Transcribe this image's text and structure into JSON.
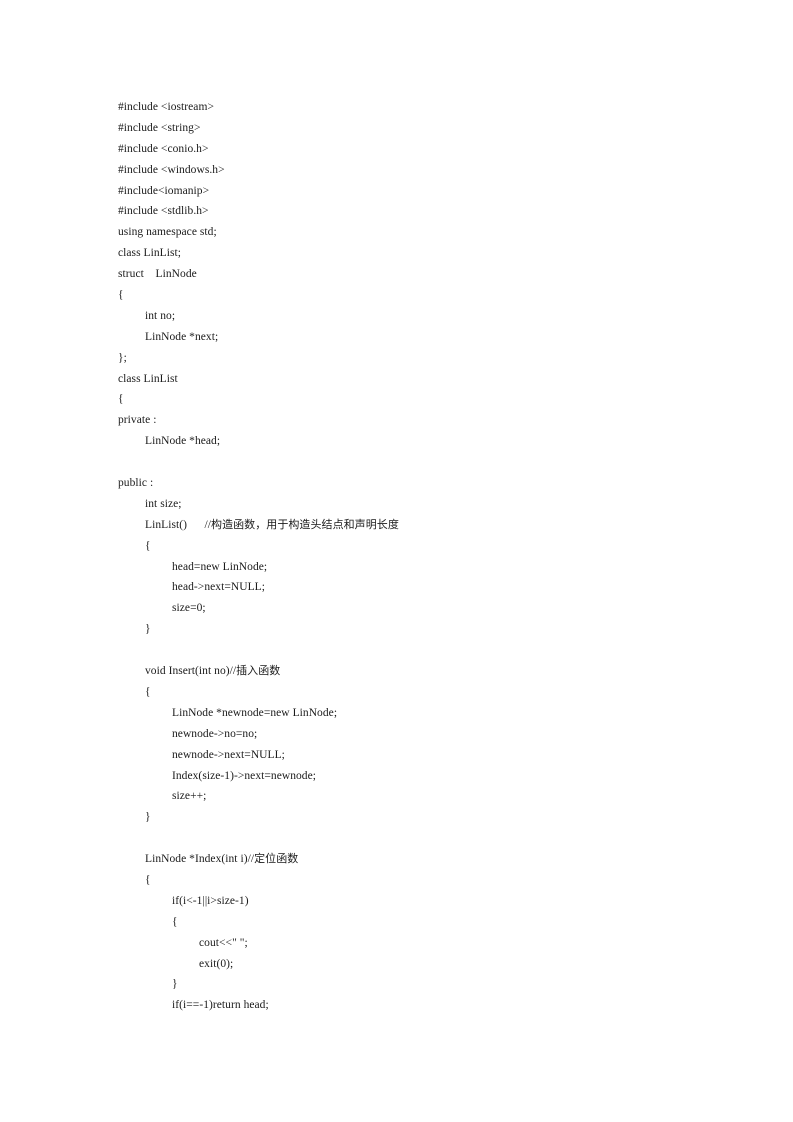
{
  "document": {
    "kind": "scanned-source-code-listing",
    "language": "C++",
    "page_background": "#ffffff",
    "text_color": "#1b1b1b",
    "lines": [
      {
        "indent": 0,
        "text": "#include <iostream>"
      },
      {
        "indent": 0,
        "text": "#include <string>"
      },
      {
        "indent": 0,
        "text": "#include <conio.h>"
      },
      {
        "indent": 0,
        "text": "#include <windows.h>"
      },
      {
        "indent": 0,
        "text": "#include<iomanip>"
      },
      {
        "indent": 0,
        "text": "#include <stdlib.h>"
      },
      {
        "indent": 0,
        "text": "using namespace std;"
      },
      {
        "indent": 0,
        "text": "class LinList;"
      },
      {
        "indent": 0,
        "text": "struct    LinNode"
      },
      {
        "indent": 0,
        "text": "{"
      },
      {
        "indent": 1,
        "text": "int no;"
      },
      {
        "indent": 1,
        "text": "LinNode *next;"
      },
      {
        "indent": 0,
        "text": "};"
      },
      {
        "indent": 0,
        "text": "class LinList"
      },
      {
        "indent": 0,
        "text": "{"
      },
      {
        "indent": 0,
        "text": "private :"
      },
      {
        "indent": 1,
        "text": "LinNode *head;"
      },
      {
        "indent": 0,
        "text": ""
      },
      {
        "indent": 0,
        "text": "public :"
      },
      {
        "indent": 1,
        "text": "int size;"
      },
      {
        "indent": 1,
        "text": "LinList()      //构造函数，用于构造头结点和声明长度"
      },
      {
        "indent": 1,
        "text": "{"
      },
      {
        "indent": 2,
        "text": "head=new LinNode;"
      },
      {
        "indent": 2,
        "text": "head->next=NULL;"
      },
      {
        "indent": 2,
        "text": "size=0;"
      },
      {
        "indent": 1,
        "text": "}"
      },
      {
        "indent": 0,
        "text": ""
      },
      {
        "indent": 1,
        "text": "void Insert(int no)//插入函数"
      },
      {
        "indent": 1,
        "text": "{"
      },
      {
        "indent": 2,
        "text": "LinNode *newnode=new LinNode;"
      },
      {
        "indent": 2,
        "text": "newnode->no=no;"
      },
      {
        "indent": 2,
        "text": "newnode->next=NULL;"
      },
      {
        "indent": 2,
        "text": "Index(size-1)->next=newnode;"
      },
      {
        "indent": 2,
        "text": "size++;"
      },
      {
        "indent": 1,
        "text": "}"
      },
      {
        "indent": 0,
        "text": ""
      },
      {
        "indent": 1,
        "text": "LinNode *Index(int i)//定位函数"
      },
      {
        "indent": 1,
        "text": "{"
      },
      {
        "indent": 2,
        "text": "if(i<-1||i>size-1)"
      },
      {
        "indent": 2,
        "text": "{"
      },
      {
        "indent": 3,
        "text": "cout<<\" \";"
      },
      {
        "indent": 3,
        "text": "exit(0);"
      },
      {
        "indent": 2,
        "text": "}"
      },
      {
        "indent": 2,
        "text": "if(i==-1)return head;"
      }
    ]
  }
}
